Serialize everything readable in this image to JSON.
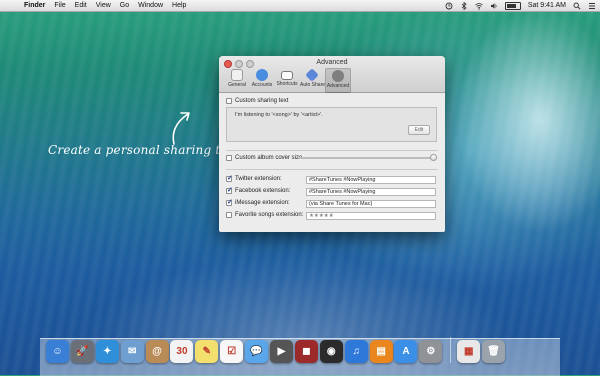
{
  "menubar": {
    "apple_glyph": "",
    "app": "Finder",
    "items": [
      "File",
      "Edit",
      "View",
      "Go",
      "Window",
      "Help"
    ],
    "clock": "Sat 9:41 AM"
  },
  "annotation": "Create a personal sharing text",
  "window": {
    "title": "Advanced",
    "toolbar": [
      {
        "label": "General",
        "icon": "general-icon",
        "color": "#e9e9e9"
      },
      {
        "label": "Accounts",
        "icon": "accounts-icon",
        "color": "#4a8de0"
      },
      {
        "label": "Shortcuts",
        "icon": "shortcuts-icon",
        "color": "#9a9a9a"
      },
      {
        "label": "Auto Share",
        "icon": "auto-share-icon",
        "color": "#5c86d8"
      },
      {
        "label": "Advanced",
        "icon": "advanced-icon",
        "color": "#7f7f7f"
      }
    ],
    "custom_sharing_text": {
      "label": "Custom sharing text",
      "checked": false
    },
    "template_text": "I'm listening to '<song>' by '<artist>'.",
    "edit_button": "Edit",
    "custom_album_cover": {
      "label": "Custom album cover size",
      "checked": false
    },
    "rows": [
      {
        "label": "Twitter extension:",
        "checked": true,
        "value": "#ShareTunes #NowPlaying"
      },
      {
        "label": "Facebook extension:",
        "checked": true,
        "value": "#ShareTunes #NowPlaying"
      },
      {
        "label": "iMessage extension:",
        "checked": true,
        "value": "(via Share Tunes for Mac)"
      },
      {
        "label": "Favorite songs extension:",
        "checked": false,
        "value": "★★★★★"
      }
    ]
  },
  "dock": {
    "apps": [
      {
        "name": "Finder",
        "glyph": "☺",
        "color": "#3a7fd6"
      },
      {
        "name": "Launchpad",
        "glyph": "🚀",
        "color": "#6b6f78"
      },
      {
        "name": "Safari",
        "glyph": "✦",
        "color": "#2f8fd8"
      },
      {
        "name": "Mail",
        "glyph": "✉",
        "color": "#6f9fd0"
      },
      {
        "name": "Contacts",
        "glyph": "@",
        "color": "#b98b57"
      },
      {
        "name": "Calendar",
        "glyph": "30",
        "color": "#f3f3f3"
      },
      {
        "name": "Notes",
        "glyph": "✎",
        "color": "#f2df6e"
      },
      {
        "name": "Reminders",
        "glyph": "☑",
        "color": "#f7f7f7"
      },
      {
        "name": "Messages",
        "glyph": "💬",
        "color": "#5aa6ea"
      },
      {
        "name": "FaceTime",
        "glyph": "▶",
        "color": "#555"
      },
      {
        "name": "Photo Booth",
        "glyph": "◼",
        "color": "#9d2a2a"
      },
      {
        "name": "iPhoto",
        "glyph": "◉",
        "color": "#2b2b2b"
      },
      {
        "name": "iTunes",
        "glyph": "♫",
        "color": "#2d78d9"
      },
      {
        "name": "iBooks",
        "glyph": "▤",
        "color": "#e9861d"
      },
      {
        "name": "App Store",
        "glyph": "A",
        "color": "#3b8fe6"
      },
      {
        "name": "System Preferences",
        "glyph": "⚙",
        "color": "#8f9297"
      }
    ],
    "right": [
      {
        "name": "Documents",
        "glyph": "▦",
        "color": "#e8e8e8"
      },
      {
        "name": "Trash",
        "glyph": "🗑",
        "color": "#9aa2ab"
      }
    ]
  }
}
